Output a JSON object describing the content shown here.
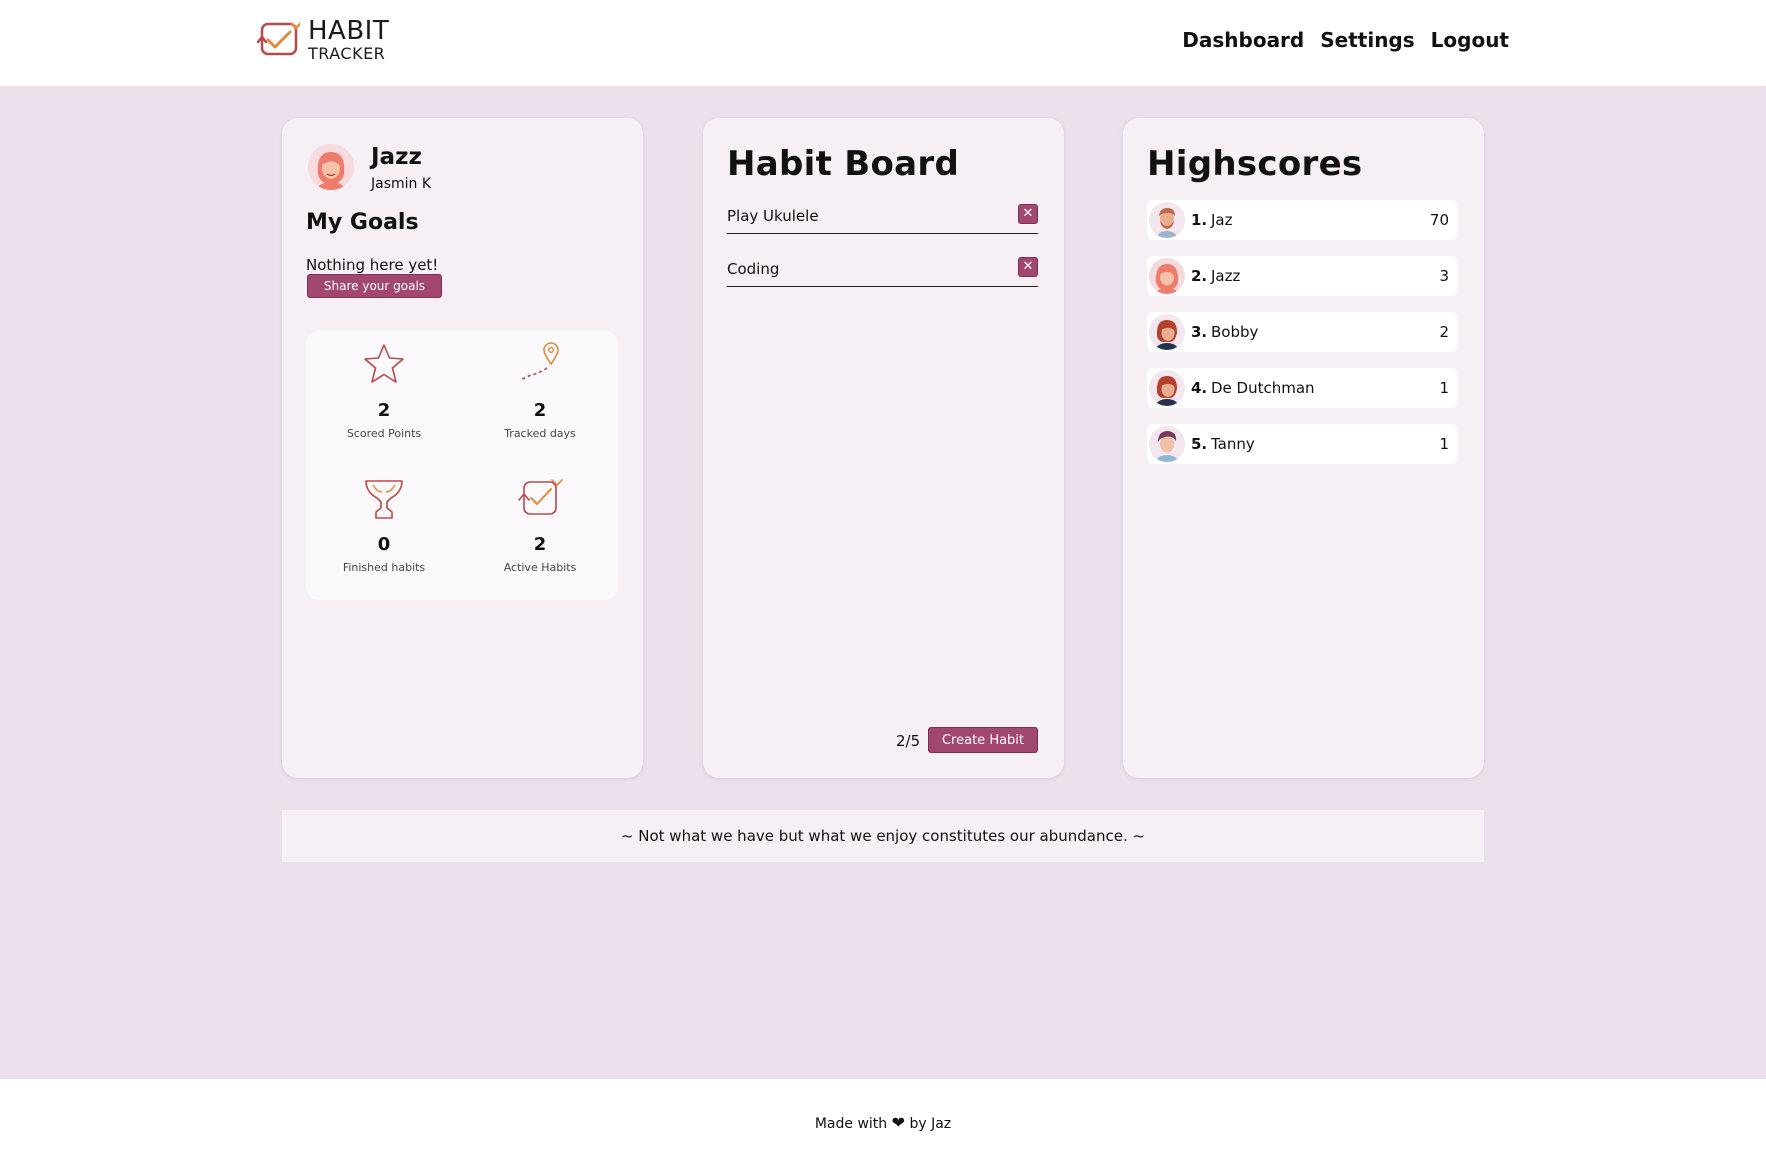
{
  "header": {
    "logo_line1": "HABIT",
    "logo_line2": "TRACKER",
    "nav": [
      "Dashboard",
      "Settings",
      "Logout"
    ]
  },
  "profile": {
    "display_name": "Jazz",
    "full_name": "Jasmin K",
    "goals_title": "My Goals",
    "goals_empty": "Nothing here yet!",
    "share_label": "Share your goals",
    "stats": [
      {
        "icon": "star-icon",
        "value": "2",
        "label": "Scored Points"
      },
      {
        "icon": "map-pin-path-icon",
        "value": "2",
        "label": "Tracked days"
      },
      {
        "icon": "trophy-icon",
        "value": "0",
        "label": "Finished habits"
      },
      {
        "icon": "habit-check-icon",
        "value": "2",
        "label": "Active Habits"
      }
    ]
  },
  "board": {
    "title": "Habit Board",
    "habits": [
      {
        "name": "Play Ukulele"
      },
      {
        "name": "Coding"
      }
    ],
    "delete_glyph": "✕",
    "count": "2/5",
    "create_label": "Create Habit"
  },
  "scores": {
    "title": "Highscores",
    "rows": [
      {
        "rank": "1.",
        "name": "Jaz",
        "score": "70"
      },
      {
        "rank": "2.",
        "name": "Jazz",
        "score": "3"
      },
      {
        "rank": "3.",
        "name": "Bobby",
        "score": "2"
      },
      {
        "rank": "4.",
        "name": "De Dutchman",
        "score": "1"
      },
      {
        "rank": "5.",
        "name": "Tanny",
        "score": "1"
      }
    ]
  },
  "quote": "~ Not what we have but what we enjoy constitutes our abundance. ~",
  "footer": {
    "prefix": "Made with",
    "heart": "❤",
    "suffix": "by Jaz"
  },
  "colors": {
    "accent": "#a2476f",
    "background": "#ebe0ec",
    "card": "#f6eff6",
    "icon_orange": "#e08a3c",
    "icon_red": "#b64a4a"
  }
}
